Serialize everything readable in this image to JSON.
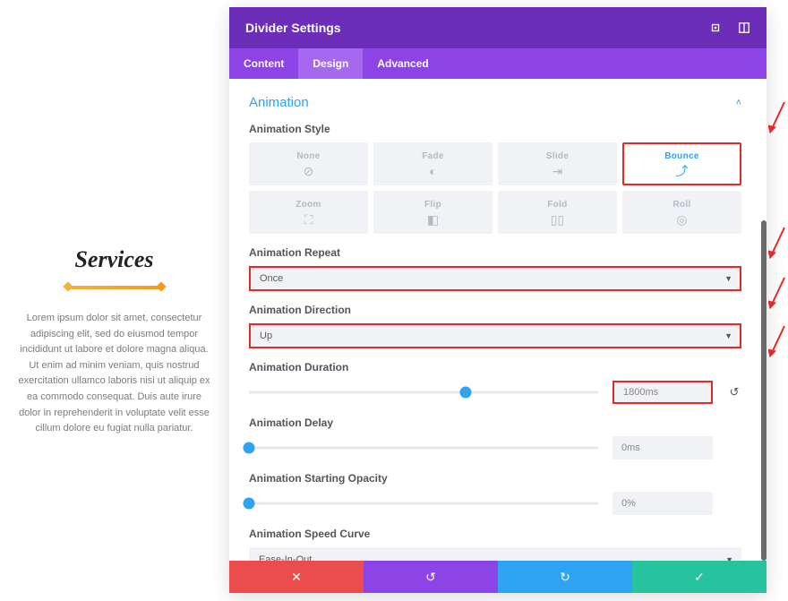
{
  "preview": {
    "heading": "Services",
    "body": "Lorem ipsum dolor sit amet, consectetur adipiscing elit, sed do eiusmod tempor incididunt ut labore et dolore magna aliqua. Ut enim ad minim veniam, quis nostrud exercitation ullamco laboris nisi ut aliquip ex ea commodo consequat. Duis aute irure dolor in reprehenderit in voluptate velit esse cillum dolore eu fugiat nulla pariatur."
  },
  "modal": {
    "title": "Divider Settings",
    "tabs": {
      "content": "Content",
      "design": "Design",
      "advanced": "Advanced"
    },
    "section_title": "Animation",
    "labels": {
      "style": "Animation Style",
      "repeat": "Animation Repeat",
      "direction": "Animation Direction",
      "duration": "Animation Duration",
      "delay": "Animation Delay",
      "opacity": "Animation Starting Opacity",
      "curve": "Animation Speed Curve"
    },
    "styles": [
      {
        "key": "none",
        "label": "None",
        "icon": "⊘"
      },
      {
        "key": "fade",
        "label": "Fade",
        "icon": "◐"
      },
      {
        "key": "slide",
        "label": "Slide",
        "icon": "⇥"
      },
      {
        "key": "bounce",
        "label": "Bounce",
        "icon": "⤴"
      },
      {
        "key": "zoom",
        "label": "Zoom",
        "icon": "⛶"
      },
      {
        "key": "flip",
        "label": "Flip",
        "icon": "◧"
      },
      {
        "key": "fold",
        "label": "Fold",
        "icon": "▯▯"
      },
      {
        "key": "roll",
        "label": "Roll",
        "icon": "◎"
      }
    ],
    "selected_style": "bounce",
    "repeat_value": "Once",
    "direction_value": "Up",
    "duration_value": "1800ms",
    "delay_value": "0ms",
    "opacity_value": "0%",
    "curve_value": "Ease-In-Out",
    "duration_pct": 62,
    "delay_pct": 0,
    "opacity_pct": 0
  }
}
